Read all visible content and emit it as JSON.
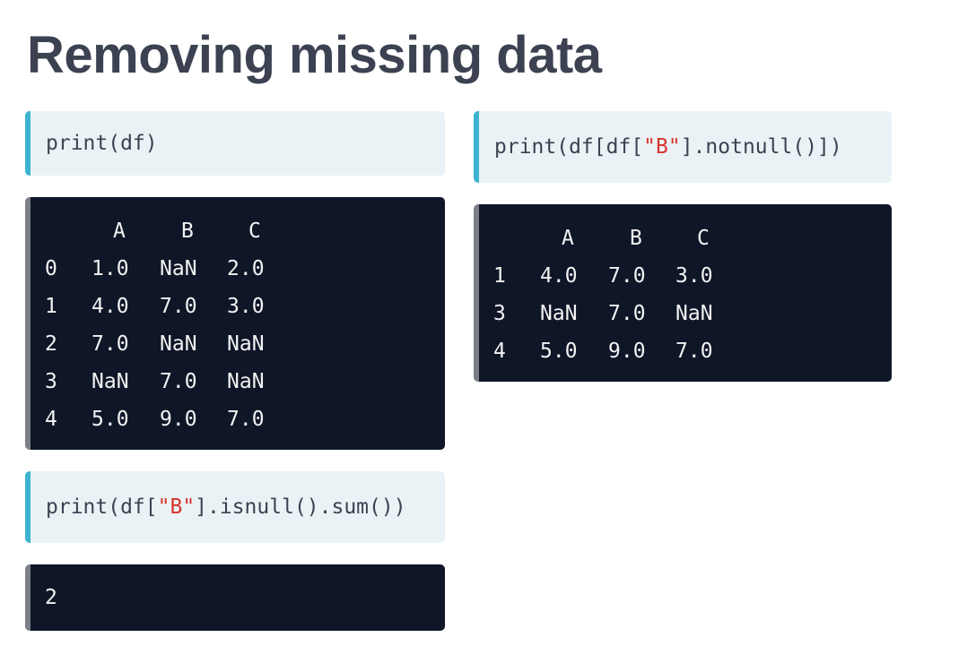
{
  "title": "Removing missing data",
  "code1": {
    "text": "print(df)"
  },
  "output1": {
    "columns": [
      "A",
      "B",
      "C"
    ],
    "rows": [
      {
        "index": "0",
        "values": [
          "1.0",
          "NaN",
          "2.0"
        ]
      },
      {
        "index": "1",
        "values": [
          "4.0",
          "7.0",
          "3.0"
        ]
      },
      {
        "index": "2",
        "values": [
          "7.0",
          "NaN",
          "NaN"
        ]
      },
      {
        "index": "3",
        "values": [
          "NaN",
          "7.0",
          "NaN"
        ]
      },
      {
        "index": "4",
        "values": [
          "5.0",
          "9.0",
          "7.0"
        ]
      }
    ]
  },
  "code2": {
    "prefix": "print(df[",
    "string": "\"B\"",
    "suffix": "].isnull().sum())"
  },
  "output2": {
    "text": "2"
  },
  "code3": {
    "prefix": "print(df[df[",
    "string": "\"B\"",
    "suffix": "].notnull()])"
  },
  "output3": {
    "columns": [
      "A",
      "B",
      "C"
    ],
    "rows": [
      {
        "index": "1",
        "values": [
          "4.0",
          "7.0",
          "3.0"
        ]
      },
      {
        "index": "3",
        "values": [
          "NaN",
          "7.0",
          "NaN"
        ]
      },
      {
        "index": "4",
        "values": [
          "5.0",
          "9.0",
          "7.0"
        ]
      }
    ]
  },
  "colors": {
    "title": "#3d4252",
    "code_bg": "#ebf2f5",
    "code_accent": "#3eb3d1",
    "output_bg": "#0e1627",
    "output_accent": "#7b8088",
    "string": "#d6342c"
  }
}
